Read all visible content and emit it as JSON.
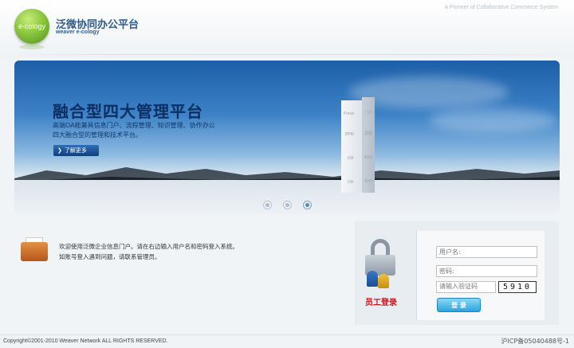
{
  "header": {
    "logo_text": "e-cology",
    "brand_cn": "泛微协同办公平台",
    "brand_en": "weaver e-cology",
    "tagline": "A Pioneer of Collaborative Commerce System"
  },
  "banner": {
    "title": "融合型四大管理平台",
    "description_line1": "高端OA能兼具信息门户、流程管理、知识管理、协作办公",
    "description_line2": "四大融合型的管理和技术平台。",
    "more_label": "了解更多",
    "tower_labels": [
      "Portal",
      "门户",
      "BPM",
      "流程",
      "KM",
      "知识",
      "OA",
      "协作"
    ],
    "slides": [
      {
        "name": "slide-1",
        "active": false
      },
      {
        "name": "slide-2",
        "active": false
      },
      {
        "name": "slide-3",
        "active": true
      }
    ]
  },
  "welcome": {
    "line1": "欢迎使用泛微企业信息门户。请在右边输入用户名和密码登入系统。",
    "line2": "如账号登入遇到问题，请联系管理员。"
  },
  "login": {
    "title": "员工登录",
    "username_placeholder": "用户名:",
    "password_placeholder": "密码:",
    "verify_placeholder": "请输入验证码",
    "captcha": "5910",
    "submit_label": "登 录"
  },
  "footer": {
    "copyright": "Copyright©2001-2010 Weaver Network ALL RIGHTS RESERVED.",
    "icp": "沪ICP备05040488号-1"
  },
  "colors": {
    "accent_blue": "#2f5b8e",
    "login_red": "#c8151b",
    "button_blue": "#29a4e0"
  }
}
